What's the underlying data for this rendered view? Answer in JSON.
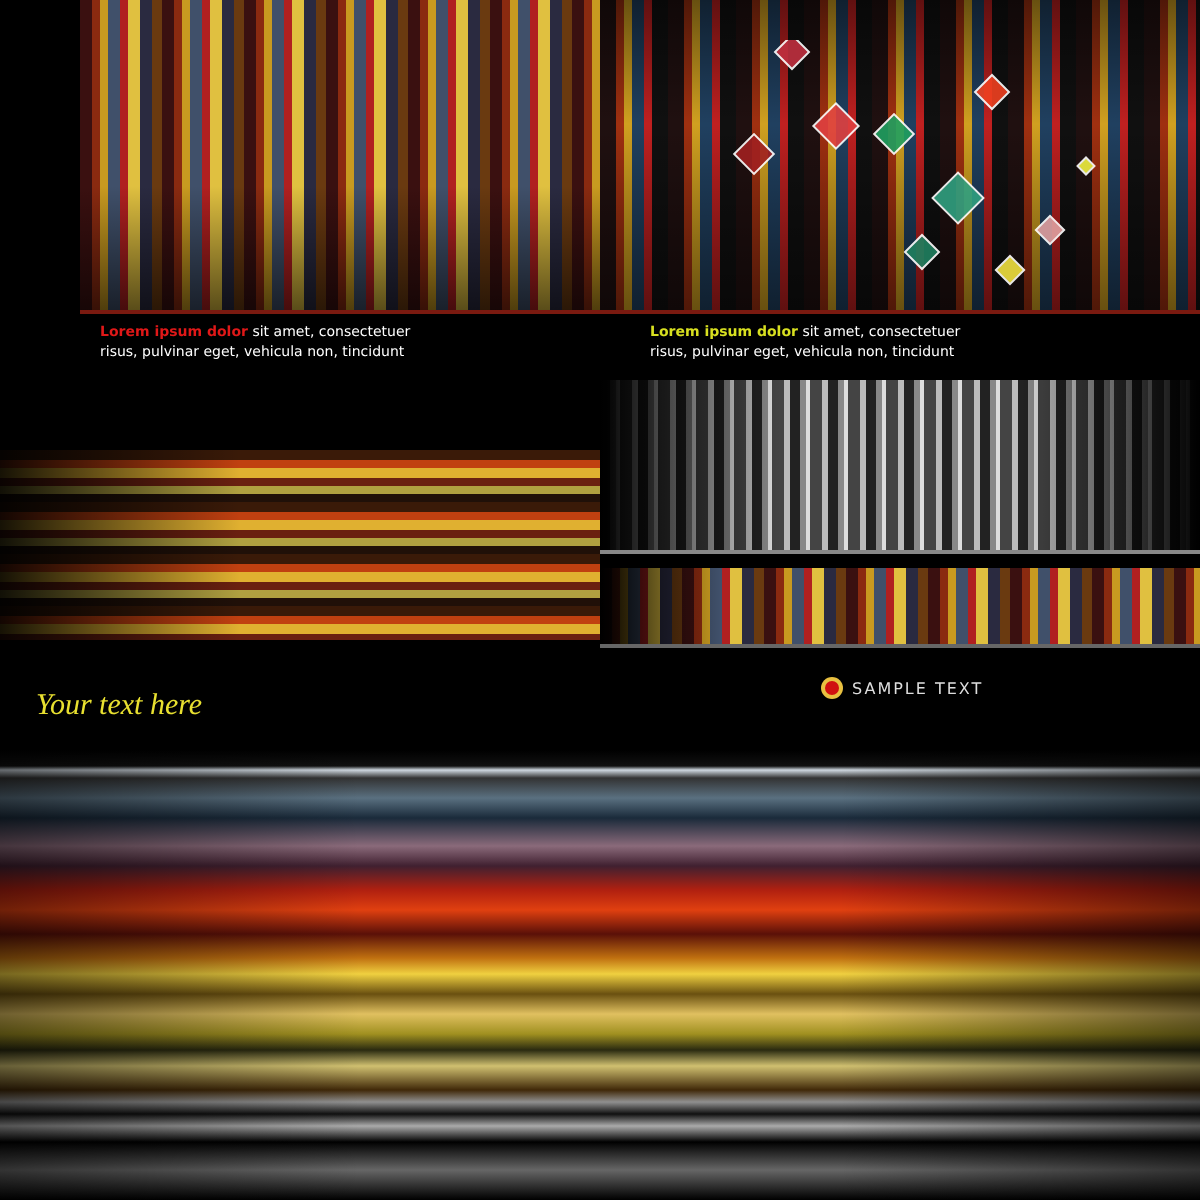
{
  "cards": [
    {
      "lead": "Lorem ipsum dolor",
      "color": "#e01818",
      "body": "sit amet, consectetuer",
      "body_line2": "risus, pulvinar eget, vehicula non, tincidunt"
    },
    {
      "lead": "Lorem ipsum dolor",
      "color": "#d8e020",
      "body": "sit amet, consectetuer",
      "body_line2": "risus, pulvinar eget, vehicula non, tincidunt"
    }
  ],
  "script_caption": "Your text here",
  "sample_label": "SAMPLE TEXT"
}
